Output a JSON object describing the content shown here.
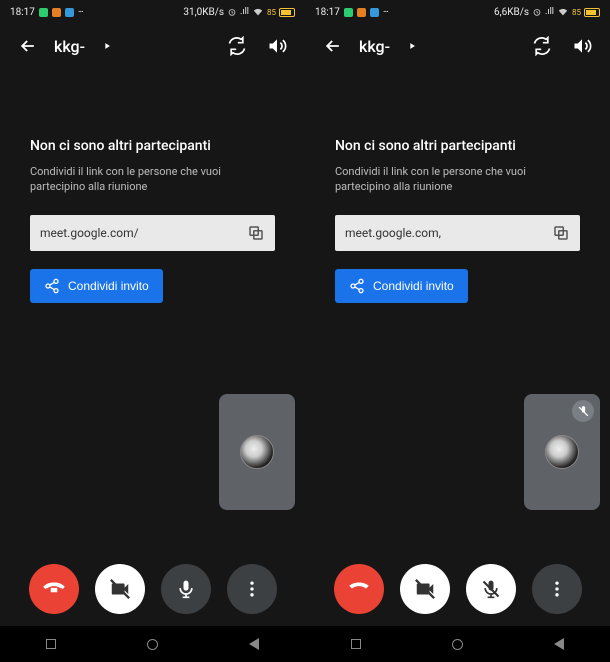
{
  "left": {
    "status": {
      "time": "18:17",
      "net_speed": "31,0KB/s",
      "battery_pct": "85"
    },
    "appbar": {
      "title": "kkg-"
    },
    "heading": "Non ci sono altri partecipanti",
    "sub": "Condividi il link con le persone che vuoi partecipino alla riunione",
    "link": "meet.google.com/",
    "share_label": "Condividi invito",
    "pip_muted": false,
    "controls": {
      "mic_state": "on"
    }
  },
  "right": {
    "status": {
      "time": "18:17",
      "net_speed": "6,6KB/s",
      "battery_pct": "85"
    },
    "appbar": {
      "title": "kkg-"
    },
    "heading": "Non ci sono altri partecipanti",
    "sub": "Condividi il link con le persone che vuoi partecipino alla riunione",
    "link": "meet.google.com,",
    "share_label": "Condividi invito",
    "pip_muted": true,
    "controls": {
      "mic_state": "off"
    }
  },
  "icons": {
    "back": "back-icon",
    "play": "play-icon",
    "switch_cam": "switch-camera-icon",
    "volume": "volume-icon",
    "copy": "copy-icon",
    "share": "share-icon",
    "hangup": "hangup-icon",
    "cam_off": "camera-off-icon",
    "mic_on": "mic-icon",
    "mic_off": "mic-off-icon",
    "more": "more-icon"
  }
}
